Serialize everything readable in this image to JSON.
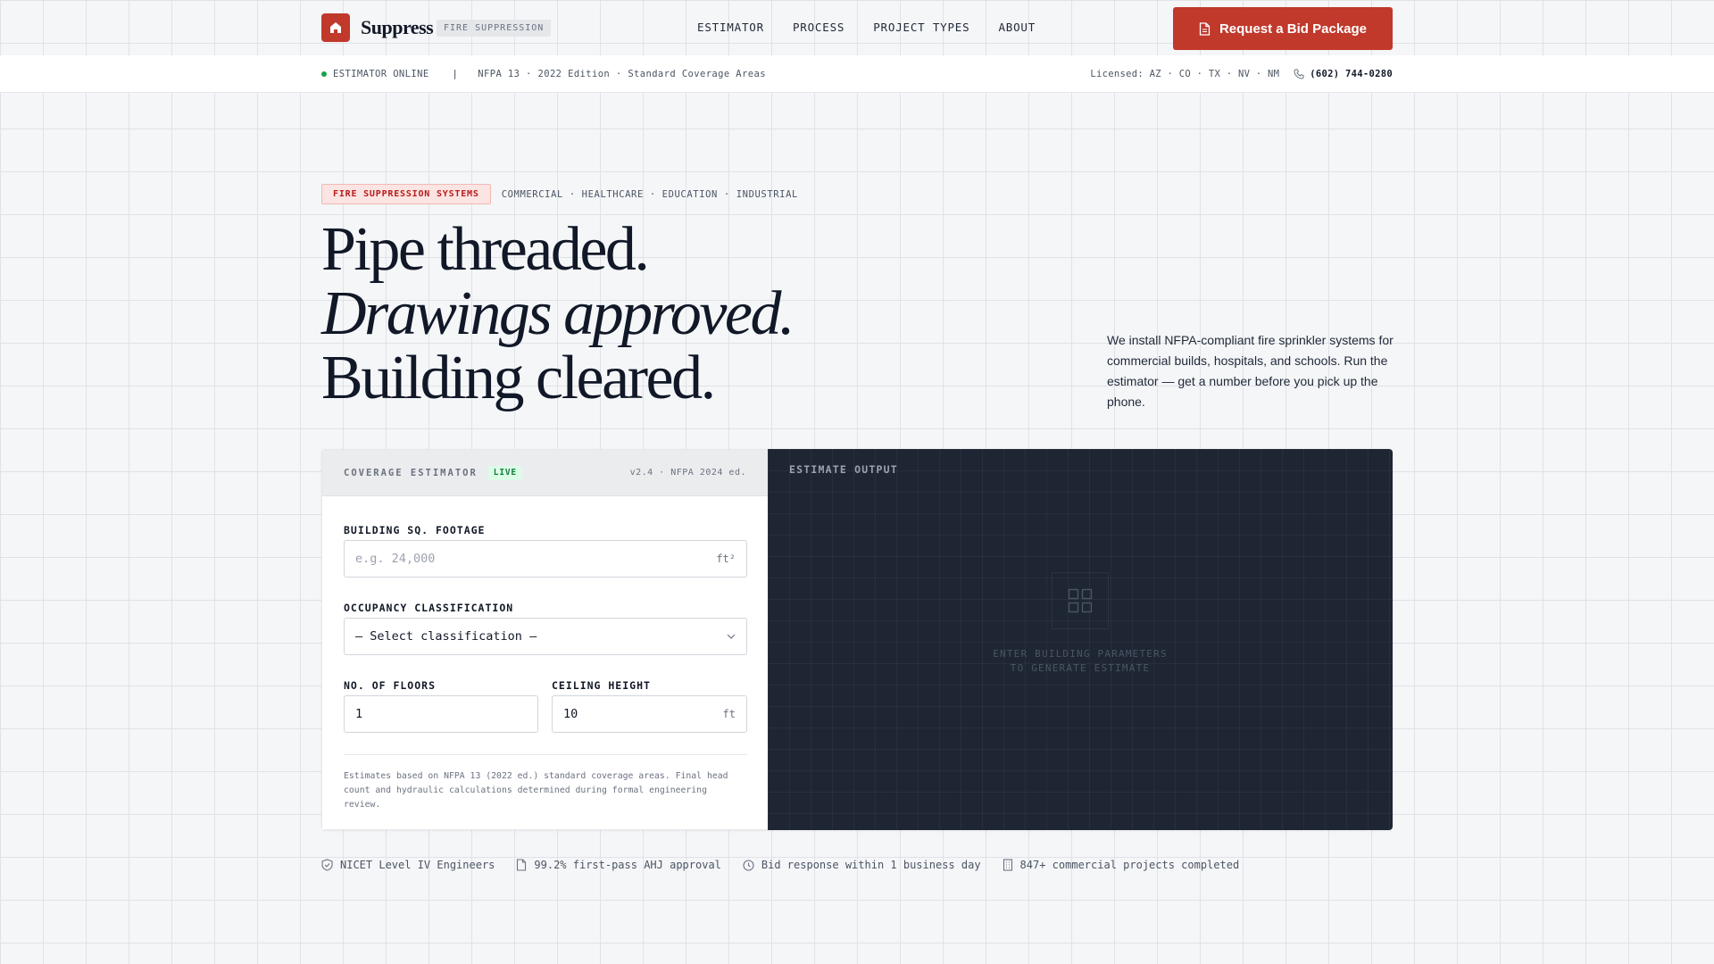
{
  "brand": {
    "name": "Suppress",
    "badge": "FIRE SUPPRESSION",
    "accent": "#c0392b"
  },
  "nav": {
    "items": [
      "ESTIMATOR",
      "PROCESS",
      "PROJECT TYPES",
      "ABOUT"
    ],
    "cta_label": "Request a Bid Package"
  },
  "status": {
    "online": "ESTIMATOR ONLINE",
    "separator": "|",
    "standard": "NFPA 13 · 2022 Edition · Standard Coverage Areas",
    "licensed": "Licensed: AZ · CO · TX · NV · NM",
    "phone": "(602) 744-0280"
  },
  "hero": {
    "tag": "FIRE SUPPRESSION SYSTEMS",
    "sectors": "COMMERCIAL · HEALTHCARE · EDUCATION · INDUSTRIAL",
    "title_line1": "Pipe threaded.",
    "title_line2": "Drawings approved.",
    "title_line3": "Building cleared.",
    "description": "We install NFPA-compliant fire sprinkler systems for commercial builds, hospitals, and schools. Run the estimator — get a number before you pick up the phone."
  },
  "estimator": {
    "title": "COVERAGE ESTIMATOR",
    "live": "LIVE",
    "version": "v2.4 · NFPA 2024 ed.",
    "sqft_label": "BUILDING SQ. FOOTAGE",
    "sqft_placeholder": "e.g. 24,000",
    "sqft_unit": "ft²",
    "occupancy_label": "OCCUPANCY CLASSIFICATION",
    "occupancy_value": "— Select classification —",
    "floors_label": "NO. OF FLOORS",
    "floors_value": "1",
    "ceiling_label": "CEILING HEIGHT",
    "ceiling_value": "10",
    "ceiling_unit": "ft",
    "disclaimer": "Estimates based on NFPA 13 (2022 ed.) standard coverage areas. Final head count and hydraulic calculations determined during formal engineering review."
  },
  "output": {
    "title": "ESTIMATE OUTPUT",
    "empty_line1": "ENTER BUILDING PARAMETERS",
    "empty_line2": "TO GENERATE ESTIMATE"
  },
  "trust": {
    "items": [
      {
        "icon": "shield-icon",
        "label": "NICET Level IV Engineers"
      },
      {
        "icon": "document-icon",
        "label": "99.2% first-pass AHJ approval"
      },
      {
        "icon": "clock-icon",
        "label": "Bid response within 1 business day"
      },
      {
        "icon": "building-icon",
        "label": "847+ commercial projects completed"
      }
    ]
  }
}
